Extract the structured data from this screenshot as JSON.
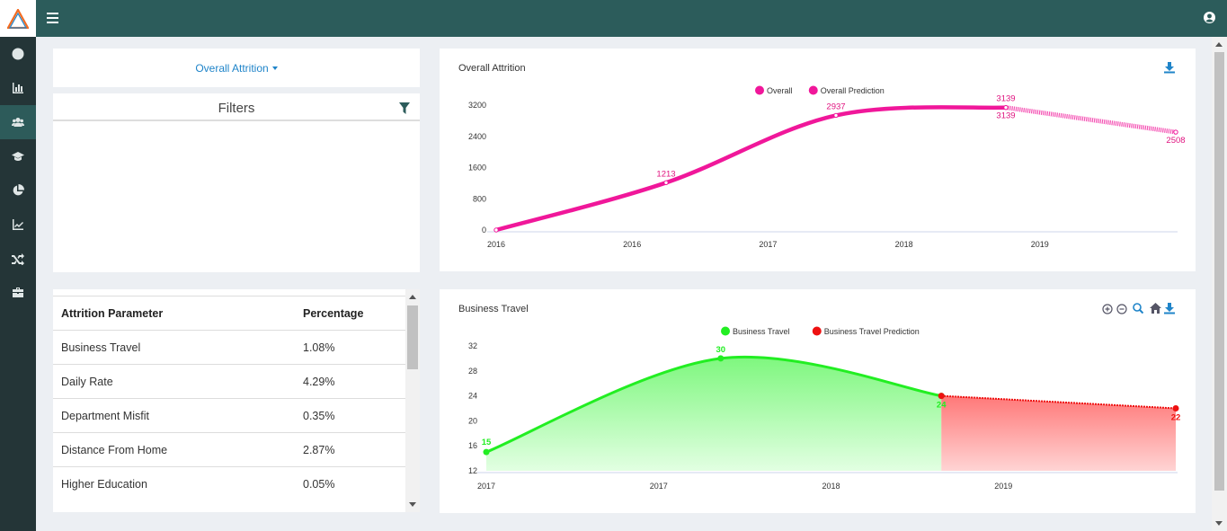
{
  "nav": {
    "items": [
      {
        "icon": "globe-icon",
        "active": false
      },
      {
        "icon": "bar-chart-icon",
        "active": false
      },
      {
        "icon": "users-icon",
        "active": true
      },
      {
        "icon": "graduation-cap-icon",
        "active": false
      },
      {
        "icon": "pie-chart-icon",
        "active": false
      },
      {
        "icon": "line-chart-icon",
        "active": false
      },
      {
        "icon": "shuffle-icon",
        "active": false
      },
      {
        "icon": "briefcase-icon",
        "active": false
      }
    ]
  },
  "dropdown": {
    "label": "Overall Attrition"
  },
  "filters": {
    "title": "Filters"
  },
  "table": {
    "headers": [
      "Attrition Parameter",
      "Percentage"
    ],
    "rows": [
      {
        "param": "Business Travel",
        "pct": "1.08%"
      },
      {
        "param": "Daily Rate",
        "pct": "4.29%"
      },
      {
        "param": "Department Misfit",
        "pct": "0.35%"
      },
      {
        "param": "Distance From Home",
        "pct": "2.87%"
      },
      {
        "param": "Higher Education",
        "pct": "0.05%"
      }
    ]
  },
  "chart_data": [
    {
      "type": "line",
      "title": "Overall Attrition",
      "legend_position": "top",
      "series": [
        {
          "name": "Overall",
          "color": "#f0179a",
          "points": [
            {
              "x": 0,
              "y": 0
            },
            {
              "x": 0.25,
              "y": 1213
            },
            {
              "x": 0.5,
              "y": 2937
            },
            {
              "x": 0.75,
              "y": 3139
            }
          ],
          "labels": [
            "",
            "1213",
            "2937",
            "3139"
          ]
        },
        {
          "name": "Overall Prediction",
          "color": "#f0179a",
          "dashed": true,
          "points": [
            {
              "x": 0.75,
              "y": 3139
            },
            {
              "x": 1.0,
              "y": 2508
            }
          ],
          "labels": [
            "3139",
            "2508"
          ]
        }
      ],
      "x_ticks": [
        "2016",
        "2016",
        "2017",
        "2018",
        "2019"
      ],
      "y_ticks": [
        "0",
        "800",
        "1600",
        "2400",
        "3200"
      ],
      "ylim": [
        0,
        3200
      ]
    },
    {
      "type": "area",
      "title": "Business Travel",
      "legend_position": "top",
      "series": [
        {
          "name": "Business Travel",
          "color": "#22ee22",
          "points": [
            {
              "x": 0,
              "y": 15
            },
            {
              "x": 0.34,
              "y": 30
            },
            {
              "x": 0.66,
              "y": 24
            }
          ],
          "labels": [
            "15",
            "30",
            "24"
          ]
        },
        {
          "name": "Business Travel Prediction",
          "color": "#ee1111",
          "points": [
            {
              "x": 0.66,
              "y": 24
            },
            {
              "x": 1.0,
              "y": 22
            }
          ],
          "labels": [
            "",
            "22"
          ]
        }
      ],
      "x_ticks": [
        "2017",
        "2017",
        "2018",
        "2019"
      ],
      "y_ticks": [
        "12",
        "16",
        "20",
        "24",
        "28",
        "32"
      ],
      "ylim": [
        12,
        32
      ]
    }
  ]
}
